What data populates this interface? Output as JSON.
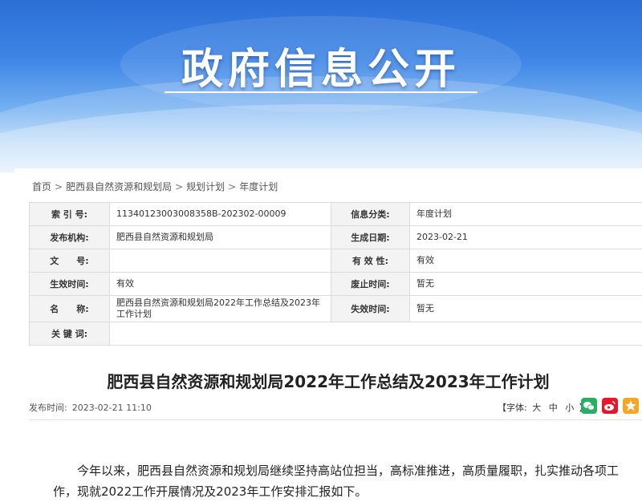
{
  "banner": {
    "title": "政府信息公开"
  },
  "breadcrumb": {
    "items": [
      "首页",
      "肥西县自然资源和规划局",
      "规划计划",
      "年度计划"
    ],
    "separator": ">"
  },
  "meta": {
    "rows": [
      [
        {
          "label": "索 引 号:",
          "value": "11340123003008358B-202302-00009"
        },
        {
          "label": "信息分类:",
          "value": "年度计划"
        }
      ],
      [
        {
          "label": "发布机构:",
          "value": "肥西县自然资源和规划局"
        },
        {
          "label": "生成日期:",
          "value": "2023-02-21"
        }
      ],
      [
        {
          "label": "文　　号:",
          "value": ""
        },
        {
          "label": "有 效 性:",
          "value": "有效"
        }
      ],
      [
        {
          "label": "生效时间:",
          "value": "有效"
        },
        {
          "label": "废止时间:",
          "value": "暂无"
        }
      ],
      [
        {
          "label": "名　　称:",
          "value": "肥西县自然资源和规划局2022年工作总结及2023年工作计划"
        },
        {
          "label": "失效时间:",
          "value": "暂无"
        }
      ],
      [
        {
          "label": "关 键 词:",
          "value": ""
        }
      ]
    ]
  },
  "article": {
    "title": "肥西县自然资源和规划局2022年工作总结及2023年工作计划",
    "publish_label": "发布时间:",
    "publish_time": "2023-02-21 11:10",
    "font_prefix": "【字体:",
    "font_large": "大",
    "font_medium": "中",
    "font_small": "小",
    "font_suffix": "】",
    "body": "今年以来，肥西县自然资源和规划局继续坚持高站位担当，高标准推进，高质量履职，扎实推动各项工作，现就2022工作开展情况及2023年工作安排汇报如下。"
  },
  "share": {
    "wechat": {
      "icon": "wechat-icon",
      "color": "#2aae67",
      "glyph": "●"
    },
    "weibo": {
      "icon": "weibo-icon",
      "color": "#e6162d",
      "glyph": "◉"
    },
    "favorite": {
      "icon": "star-icon",
      "color": "#f5a623",
      "glyph": "★"
    }
  }
}
